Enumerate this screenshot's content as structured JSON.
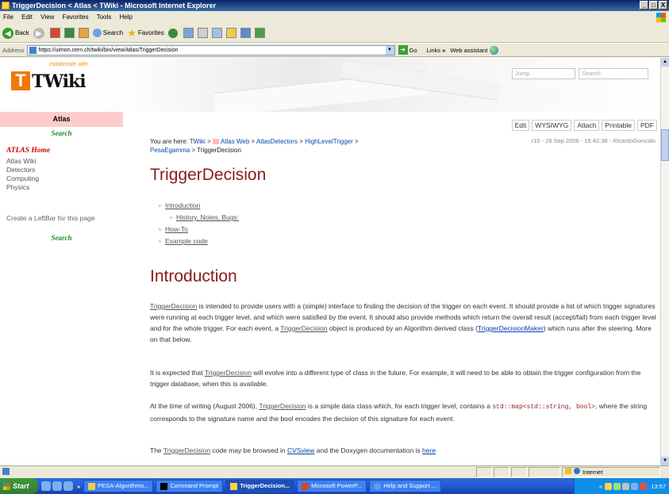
{
  "window": {
    "title": "TriggerDecision < Atlas < TWiki - Microsoft Internet Explorer",
    "controls": [
      "_",
      "□",
      "X"
    ]
  },
  "menubar": [
    "File",
    "Edit",
    "View",
    "Favorites",
    "Tools",
    "Help"
  ],
  "toolbar": {
    "back": "Back",
    "search": "Search",
    "favorites": "Favorites"
  },
  "addressbar": {
    "label": "Address",
    "url": "https://uimon.cern.ch/twiki/bin/view/Atlas/TriggerDecision",
    "go": "Go",
    "links": "Links",
    "chevrons": "»",
    "web_assistant": "Web assistant"
  },
  "header": {
    "logo_tagline": "collaborate with",
    "logo_word": "TWiki",
    "jump_placeholder": "Jump",
    "search_placeholder": "Search"
  },
  "sidebar": {
    "web_name": "Atlas",
    "search_top": "Search",
    "home": "ATLAS Home",
    "nav": [
      "Atlas Wiki",
      "Detectors",
      "Computing",
      "Physics"
    ],
    "create_leftbar": "Create a LeftBar for this page",
    "search_bottom": "Search"
  },
  "actions": {
    "edit": "Edit",
    "wysiwyg": "WYSIWYG",
    "attach": "Attach",
    "printable": "Printable",
    "pdf": "PDF"
  },
  "breadcrumb": {
    "prefix": "You are here:",
    "twiki": "TWiki",
    "sep": ">",
    "atlas_web": "Atlas Web",
    "detectors": "AtlasDetectors",
    "hlt": "HighLevelTrigger",
    "pesa": "PesaEgamma",
    "current": "TriggerDecision"
  },
  "revision": "r10 - 26 Sep 2006 - 16:42:38 - RicardoGoncalo",
  "page": {
    "title": "TriggerDecision",
    "toc": {
      "introduction": "Introduction",
      "history": "History, Notes, Bugs:",
      "howto": "How-To",
      "example": "Example code"
    },
    "section_title": "Introduction",
    "p1": {
      "td": "TriggerDecision",
      "t1": " is intended to provide users with a (simple) interface to finding the decision of the trigger on each event. It should provide a list of which trigger signatures were running at each trigger level, and which were satisfied by the event. It should also provide methods which return the overall result (accept/fail) from each trigger level and for the whole trigger. For each event, a ",
      "td2": "TriggerDecision",
      "t2": " object is produced by an Algorithm derived class (",
      "maker": "TriggerDecisionMaker",
      "t3": ") which runs after the steering. More on that below."
    },
    "p2": {
      "t1": "It is expected that ",
      "td": "TriggerDecision",
      "t2": " will evolve into a different type of class in the future. For example, it will need to be able to obtain the trigger configuration from the trigger database, when this is available."
    },
    "p3": {
      "t1": "At the time of writing (August 2006), ",
      "td": "TriggerDecision",
      "t2": " is a simple data class which, for each trigger level, contains a ",
      "code": "std::map<std::string, bool>",
      "t3": ", where the string corresponds to the signature name and the bool encodes the decision of this signature for each event."
    },
    "p4": {
      "t1": "The ",
      "td": "TriggerDecision",
      "t2": " code may be browsed in ",
      "cvs": "CVSview",
      "t3": " and the Doxygen documentation is ",
      "here": "here"
    }
  },
  "statusbar": {
    "zone": "Internet"
  },
  "taskbar": {
    "start": "Start",
    "chevron": "»",
    "tasks": [
      "PESA-Algorithms...",
      "Command Prompt",
      "TriggerDecision...",
      "Microsoft PowerP...",
      "Help and Support ..."
    ],
    "clock": "13:57",
    "tray_chevron": "«"
  }
}
